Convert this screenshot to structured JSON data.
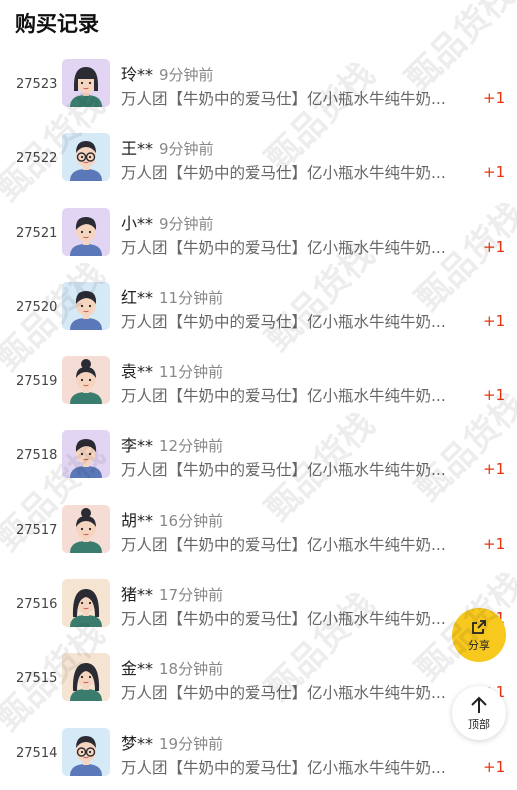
{
  "page_title": "购买记录",
  "rows": [
    {
      "num": "27523",
      "name": "玲**",
      "time": "9分钟前",
      "product": "万人团【牛奶中的爱马仕】亿小瓶水牛纯牛奶...",
      "qty": "+1",
      "avatar": "female-short-hair-icon",
      "bg": "#e2d4f3"
    },
    {
      "num": "27522",
      "name": "王**",
      "time": "9分钟前",
      "product": "万人团【牛奶中的爱马仕】亿小瓶水牛纯牛奶...",
      "qty": "+1",
      "avatar": "male-glasses-icon",
      "bg": "#d6e9f7"
    },
    {
      "num": "27521",
      "name": "小**",
      "time": "9分钟前",
      "product": "万人团【牛奶中的爱马仕】亿小瓶水牛纯牛奶...",
      "qty": "+1",
      "avatar": "male-boy-icon",
      "bg": "#e2d4f3"
    },
    {
      "num": "27520",
      "name": "红**",
      "time": "11分钟前",
      "product": "万人团【牛奶中的爱马仕】亿小瓶水牛纯牛奶...",
      "qty": "+1",
      "avatar": "male-boy-icon",
      "bg": "#d6e9f7"
    },
    {
      "num": "27519",
      "name": "袁**",
      "time": "11分钟前",
      "product": "万人团【牛奶中的爱马仕】亿小瓶水牛纯牛奶...",
      "qty": "+1",
      "avatar": "female-bun-icon",
      "bg": "#f5dcd4"
    },
    {
      "num": "27518",
      "name": "李**",
      "time": "12分钟前",
      "product": "万人团【牛奶中的爱马仕】亿小瓶水牛纯牛奶...",
      "qty": "+1",
      "avatar": "male-boy-icon",
      "bg": "#e2d4f3"
    },
    {
      "num": "27517",
      "name": "胡**",
      "time": "16分钟前",
      "product": "万人团【牛奶中的爱马仕】亿小瓶水牛纯牛奶...",
      "qty": "+1",
      "avatar": "female-bun-icon",
      "bg": "#f5dcd4"
    },
    {
      "num": "27516",
      "name": "猪**",
      "time": "17分钟前",
      "product": "万人团【牛奶中的爱马仕】亿小瓶水牛纯牛奶...",
      "qty": "+1",
      "avatar": "female-long-hair-icon",
      "bg": "#f5e4d2"
    },
    {
      "num": "27515",
      "name": "金**",
      "time": "18分钟前",
      "product": "万人团【牛奶中的爱马仕】亿小瓶水牛纯牛奶...",
      "qty": "+1",
      "avatar": "female-long-hair-icon",
      "bg": "#f5e4d2"
    },
    {
      "num": "27514",
      "name": "梦**",
      "time": "19分钟前",
      "product": "万人团【牛奶中的爱马仕】亿小瓶水牛纯牛奶...",
      "qty": "+1",
      "avatar": "male-glasses-icon",
      "bg": "#d6e9f7"
    }
  ],
  "share_button": {
    "label": "分享",
    "icon": "share-icon"
  },
  "top_button": {
    "label": "顶部",
    "icon": "arrow-up-icon"
  },
  "watermark_text": "甄品货栈",
  "colors": {
    "accent": "#f7c81e",
    "qty": "#e8340d"
  }
}
